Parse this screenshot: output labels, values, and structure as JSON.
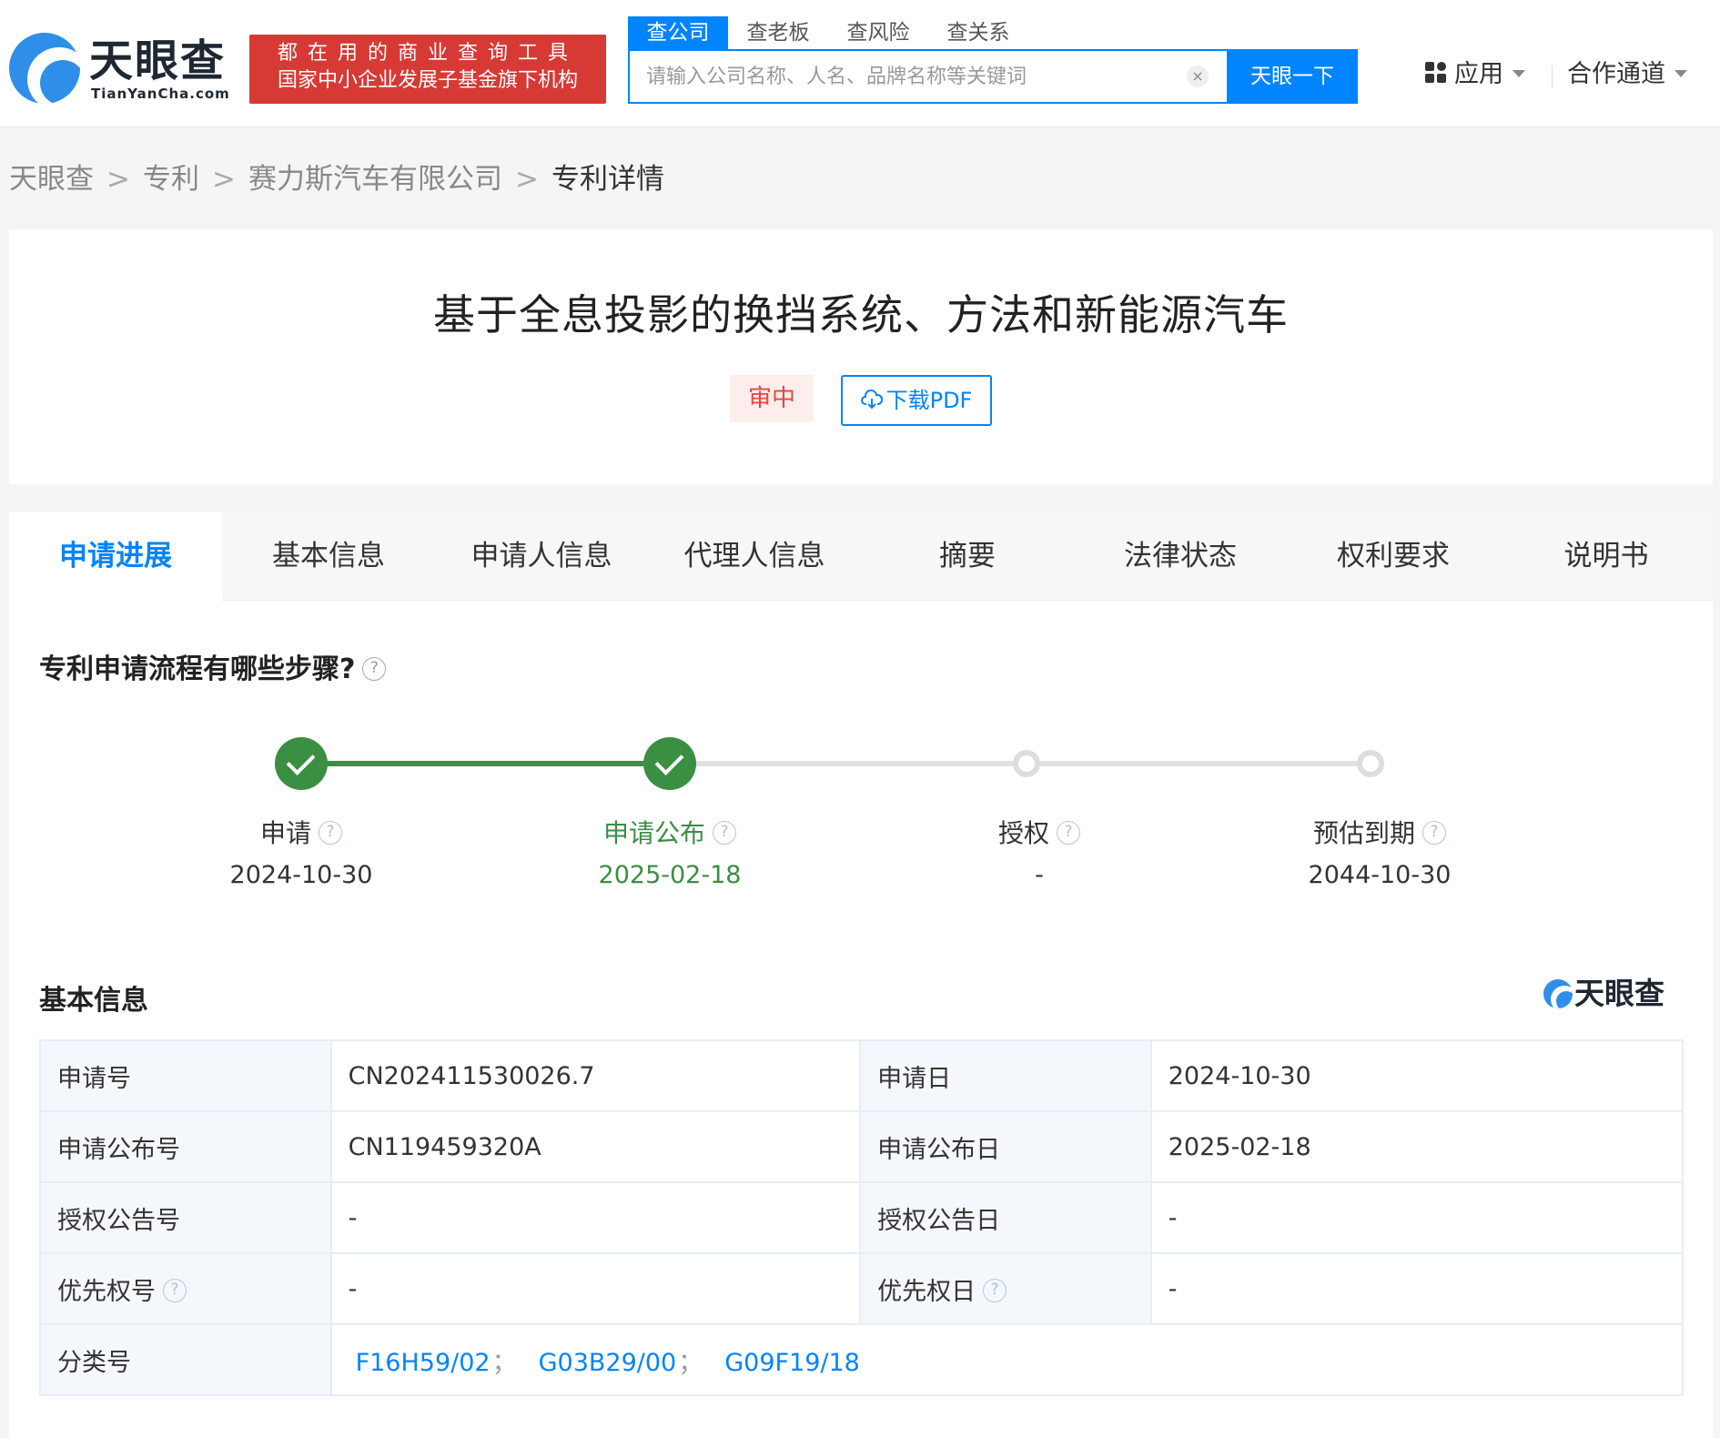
{
  "header": {
    "logo_text": "天眼查",
    "logo_sub": "TianYanCha.com",
    "slogan_line1": "都在用的商业查询工具",
    "slogan_line2": "国家中小企业发展子基金旗下机构",
    "search_tabs": [
      "查公司",
      "查老板",
      "查风险",
      "查关系"
    ],
    "search_placeholder": "请输入公司名称、人名、品牌名称等关键词",
    "clear_glyph": "×",
    "search_button": "天眼一下",
    "apps_label": "应用",
    "partner_label": "合作通道"
  },
  "breadcrumb": {
    "items": [
      "天眼查",
      "专利",
      "赛力斯汽车有限公司"
    ],
    "separator": ">",
    "current": "专利详情"
  },
  "patent": {
    "title": "基于全息投影的换挡系统、方法和新能源汽车",
    "status": "审中",
    "download_label": "下载PDF"
  },
  "tabs": [
    "申请进展",
    "基本信息",
    "申请人信息",
    "代理人信息",
    "摘要",
    "法律状态",
    "权利要求",
    "说明书"
  ],
  "progress": {
    "title": "专利申请流程有哪些步骤?",
    "help_glyph": "?",
    "steps": [
      {
        "label": "申请",
        "date": "2024-10-30"
      },
      {
        "label": "申请公布",
        "date": "2025-02-18"
      },
      {
        "label": "授权",
        "date": "-"
      },
      {
        "label": "预估到期",
        "date": "2044-10-30"
      }
    ]
  },
  "basic_info": {
    "title": "基本信息",
    "brand": "天眼查",
    "rows": [
      {
        "k1": "申请号",
        "v1": "CN202411530026.7",
        "k2": "申请日",
        "v2": "2024-10-30"
      },
      {
        "k1": "申请公布号",
        "v1": "CN119459320A",
        "k2": "申请公布日",
        "v2": "2025-02-18"
      },
      {
        "k1": "授权公告号",
        "v1": "-",
        "k2": "授权公告日",
        "v2": "-"
      },
      {
        "k1": "优先权号",
        "v1": "-",
        "k2": "优先权日",
        "v2": "-"
      }
    ],
    "classification_label": "分类号",
    "classification": [
      "F16H59/02",
      "G03B29/00",
      "G09F19/18"
    ],
    "classification_sep": "；"
  },
  "colors": {
    "accent": "#0084ff",
    "success": "#3a8f43",
    "danger": "#e5473a",
    "slogan_bg": "#d73a35"
  }
}
